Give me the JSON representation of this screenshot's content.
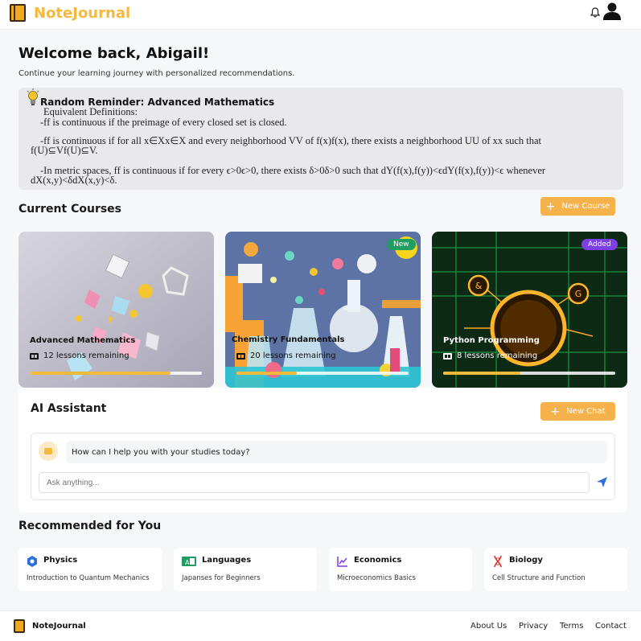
{
  "header": {
    "brand": "NoteJournal",
    "bell_icon": "bell-icon",
    "user_icon": "user-icon"
  },
  "welcome": {
    "title": "Welcome back, Abigail!",
    "subtitle": "Continue your learning journey with personalized recommendations."
  },
  "reminder": {
    "icon": "lightbulb-icon",
    "title": "Random Reminder: Advanced Mathematics",
    "lines": [
      "Equivalent Definitions:",
      "-ff is continuous if the preimage of every closed set is closed.",
      "-ff is continuous if for all x∈Xx∈X and every neighborhood VV of f(x)f(x), there exists a neighborhood UU of xx such that",
      "f(U)⊆Vf(U)⊆V.",
      "-In metric spaces, ff is continuous if for every ϵ>0ϵ>0, there exists δ>0δ>0 such that dY(f(x),f(y))<ϵdY(f(x),f(y))<ϵ whenever",
      "dX(x,y)<δdX(x,y)<δ."
    ]
  },
  "courses": {
    "title": "Current Courses",
    "new_button": "New Course",
    "items": [
      {
        "title": "Advanced Mathematics",
        "lessons": "12 lessons remaining",
        "progress": 0.82,
        "badge": ""
      },
      {
        "title": "Chemistry Fundamentals",
        "lessons": "20 lessons remaining",
        "progress": 0.35,
        "badge": "New",
        "badge_color": "#1f9d63"
      },
      {
        "title": "Python Programming",
        "lessons": "8 lessons remaining",
        "progress": 0.45,
        "badge": "Added",
        "badge_color": "#7b3fe4"
      }
    ]
  },
  "assistant": {
    "title": "AI Assistant",
    "new_button": "New Chat",
    "bot_message": "How can I help you with your studies today?",
    "input_placeholder": "Ask anything...",
    "send_icon": "send-icon"
  },
  "recommended": {
    "title": "Recommended for You",
    "items": [
      {
        "title": "Physics",
        "subtitle": "Introduction to Quantum Mechanics",
        "icon": "atom-icon",
        "color": "#2f6fdc"
      },
      {
        "title": "Languages",
        "subtitle": "Japanses for Beginners",
        "icon": "translate-icon",
        "color": "#1f9d63"
      },
      {
        "title": "Economics",
        "subtitle": "Microeconomics Basics",
        "icon": "chart-line-icon",
        "color": "#7b3fe4"
      },
      {
        "title": "Biology",
        "subtitle": "Cell Structure and Function",
        "icon": "dna-icon",
        "color": "#d8342c"
      }
    ]
  },
  "footer": {
    "brand": "NoteJournal",
    "links": [
      "About Us",
      "Privacy",
      "Terms",
      "Contact"
    ]
  },
  "colors": {
    "accent": "#f5b93b",
    "button": "#f6b24a"
  }
}
